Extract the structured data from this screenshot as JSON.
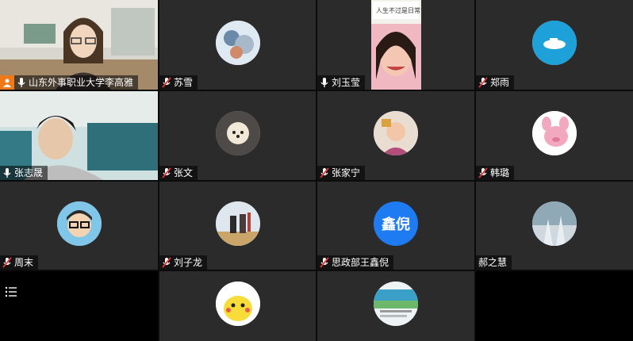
{
  "meeting": {
    "participants": [
      {
        "name": "山东外事职业大学李高雅",
        "host": true,
        "mic": "on"
      },
      {
        "name": "苏雪",
        "mic": "muted"
      },
      {
        "name": "刘玉莹",
        "mic": "on"
      },
      {
        "name": "郑雨",
        "mic": "muted"
      },
      {
        "name": "张志晟",
        "mic": "on"
      },
      {
        "name": "张文",
        "mic": "muted"
      },
      {
        "name": "张家宁",
        "mic": "muted"
      },
      {
        "name": "韩璐",
        "mic": "muted"
      },
      {
        "name": "周末",
        "mic": "muted"
      },
      {
        "name": "刘子龙",
        "mic": "muted"
      },
      {
        "name": "思政部王鑫倪",
        "mic": "muted",
        "avatar_text": "鑫倪"
      },
      {
        "name": "郝之慧",
        "mic": "none"
      },
      {
        "name": "",
        "mic": "none"
      },
      {
        "name": "",
        "mic": "none"
      }
    ],
    "menu_icon": "list-menu-icon",
    "colors": {
      "tile_bg": "#2b2b2c",
      "host_badge": "#f07a1a",
      "muted_mic": "#e0363a",
      "text_avatar_bg": "#1f7bf2"
    }
  }
}
